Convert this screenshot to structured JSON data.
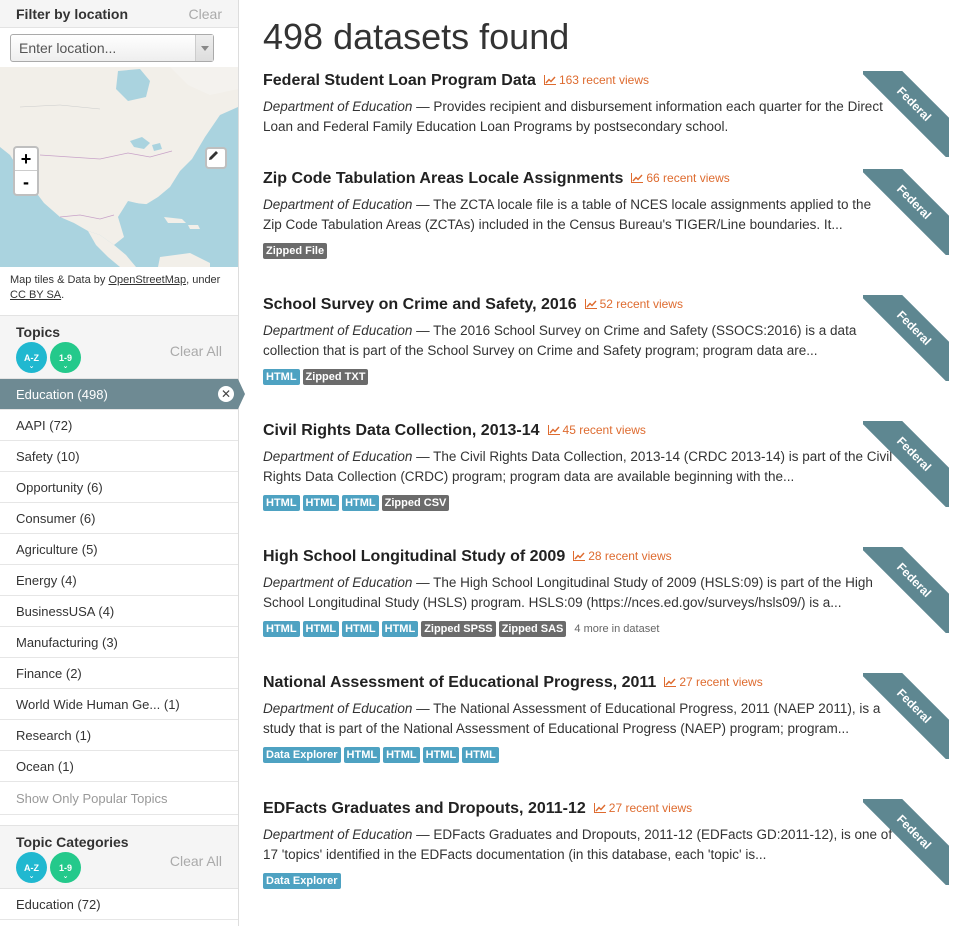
{
  "sidebar": {
    "filter_title": "Filter by location",
    "filter_clear": "Clear",
    "location_placeholder": "Enter location...",
    "map": {
      "zoom_in": "+",
      "zoom_out": "-",
      "attrib_prefix": "Map tiles & Data by ",
      "attrib_link1": "OpenStreetMap",
      "attrib_mid": ", under",
      "attrib_link2": "CC BY SA",
      "attrib_suffix": "."
    },
    "topics": {
      "title": "Topics",
      "sort_az": "A-Z",
      "sort_19": "1-9",
      "clear_all": "Clear All",
      "items": [
        {
          "label": "Education (498)",
          "active": true
        },
        {
          "label": "AAPI (72)"
        },
        {
          "label": "Safety (10)"
        },
        {
          "label": "Opportunity (6)"
        },
        {
          "label": "Consumer (6)"
        },
        {
          "label": "Agriculture (5)"
        },
        {
          "label": "Energy (4)"
        },
        {
          "label": "BusinessUSA (4)"
        },
        {
          "label": "Manufacturing (3)"
        },
        {
          "label": "Finance (2)"
        },
        {
          "label": "World Wide Human Ge... (1)"
        },
        {
          "label": "Research (1)"
        },
        {
          "label": "Ocean (1)"
        }
      ],
      "show_popular": "Show Only Popular Topics"
    },
    "topic_categories": {
      "title": "Topic Categories",
      "sort_az": "A-Z",
      "sort_19": "1-9",
      "clear_all": "Clear All",
      "items": [
        {
          "label": "Education (72)"
        }
      ]
    }
  },
  "main": {
    "count_title": "498 datasets found",
    "ribbon_label": "Federal",
    "datasets": [
      {
        "title": "Federal Student Loan Program Data",
        "views": "163 recent views",
        "org": "Department of Education",
        "desc": " — Provides recipient and disbursement information each quarter for the Direct Loan and Federal Family Education Loan Programs by postsecondary school.",
        "tags": [],
        "more": ""
      },
      {
        "title": "Zip Code Tabulation Areas Locale Assignments",
        "views": "66 recent views",
        "org": "Department of Education",
        "desc": " — The ZCTA locale file is a table of NCES locale assignments applied to the Zip Code Tabulation Areas (ZCTAs) included in the Census Bureau's TIGER/Line boundaries. It...",
        "tags": [
          {
            "label": "Zipped File",
            "kind": "gray"
          }
        ],
        "more": ""
      },
      {
        "title": "School Survey on Crime and Safety, 2016",
        "views": "52 recent views",
        "org": "Department of Education",
        "desc": " — The 2016 School Survey on Crime and Safety (SSOCS:2016) is a data collection that is part of the School Survey on Crime and Safety program; program data are...",
        "tags": [
          {
            "label": "HTML",
            "kind": "blue"
          },
          {
            "label": "Zipped TXT",
            "kind": "gray"
          }
        ],
        "more": ""
      },
      {
        "title": "Civil Rights Data Collection, 2013-14",
        "views": "45 recent views",
        "org": "Department of Education",
        "desc": " — The Civil Rights Data Collection, 2013-14 (CRDC 2013-14) is part of the Civil Rights Data Collection (CRDC) program; program data are available beginning with the...",
        "tags": [
          {
            "label": "HTML",
            "kind": "blue"
          },
          {
            "label": "HTML",
            "kind": "blue"
          },
          {
            "label": "HTML",
            "kind": "blue"
          },
          {
            "label": "Zipped CSV",
            "kind": "gray"
          }
        ],
        "more": ""
      },
      {
        "title": "High School Longitudinal Study of 2009",
        "views": "28 recent views",
        "org": "Department of Education",
        "desc": " — The High School Longitudinal Study of 2009 (HSLS:09) is part of the High School Longitudinal Study (HSLS) program. HSLS:09 (https://nces.ed.gov/surveys/hsls09/) is a...",
        "tags": [
          {
            "label": "HTML",
            "kind": "blue"
          },
          {
            "label": "HTML",
            "kind": "blue"
          },
          {
            "label": "HTML",
            "kind": "blue"
          },
          {
            "label": "HTML",
            "kind": "blue"
          },
          {
            "label": "Zipped SPSS",
            "kind": "gray"
          },
          {
            "label": "Zipped SAS",
            "kind": "gray"
          }
        ],
        "more": "4 more in dataset"
      },
      {
        "title": "National Assessment of Educational Progress, 2011",
        "views": "27 recent views",
        "org": "Department of Education",
        "desc": " — The National Assessment of Educational Progress, 2011 (NAEP 2011), is a study that is part of the National Assessment of Educational Progress (NAEP) program; program...",
        "tags": [
          {
            "label": "Data Explorer",
            "kind": "blue"
          },
          {
            "label": "HTML",
            "kind": "blue"
          },
          {
            "label": "HTML",
            "kind": "blue"
          },
          {
            "label": "HTML",
            "kind": "blue"
          },
          {
            "label": "HTML",
            "kind": "blue"
          }
        ],
        "more": ""
      },
      {
        "title": "EDFacts Graduates and Dropouts, 2011-12",
        "views": "27 recent views",
        "org": "Department of Education",
        "desc": " — EDFacts Graduates and Dropouts, 2011-12 (EDFacts GD:2011-12), is one of 17 'topics' identified in the EDFacts documentation (in this database, each 'topic' is...",
        "tags": [
          {
            "label": "Data Explorer",
            "kind": "blue"
          }
        ],
        "more": ""
      }
    ]
  }
}
